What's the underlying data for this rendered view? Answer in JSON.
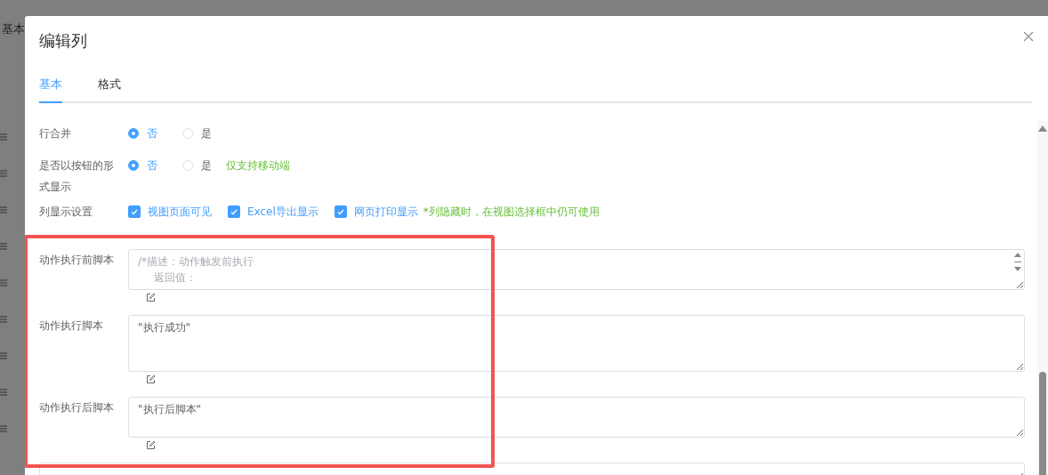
{
  "background": {
    "header_text": "基本"
  },
  "dialog": {
    "title": "编辑列"
  },
  "tabs": [
    {
      "label": "基本",
      "selected": true
    },
    {
      "label": "格式",
      "selected": false
    }
  ],
  "fields": [
    {
      "kind": "radio",
      "label": "行合并",
      "options": [
        {
          "label": "否",
          "selected": true
        },
        {
          "label": "是",
          "selected": false
        }
      ]
    },
    {
      "kind": "radio",
      "label": "是否以按钮的形式显示",
      "options": [
        {
          "label": "否",
          "selected": true
        },
        {
          "label": "是",
          "selected": false
        }
      ],
      "note": "仅支持移动端"
    },
    {
      "kind": "checkbox",
      "label": "列显示设置",
      "options": [
        {
          "label": "视图页面可见",
          "checked": true
        },
        {
          "label": "Excel导出显示",
          "checked": true
        },
        {
          "label": "网页打印显示",
          "checked": true
        }
      ],
      "note": "*列隐藏时，在视图选择框中仍可使用"
    },
    {
      "kind": "script",
      "label": "动作执行前脚本",
      "placeholder_lines": [
        "/*描述：动作触发前执行",
        "返回值："
      ]
    },
    {
      "kind": "script",
      "label": "动作执行脚本",
      "value": "\"执行成功\""
    },
    {
      "kind": "script",
      "label": "动作执行后脚本",
      "value": "\"执行后脚本\""
    }
  ]
}
